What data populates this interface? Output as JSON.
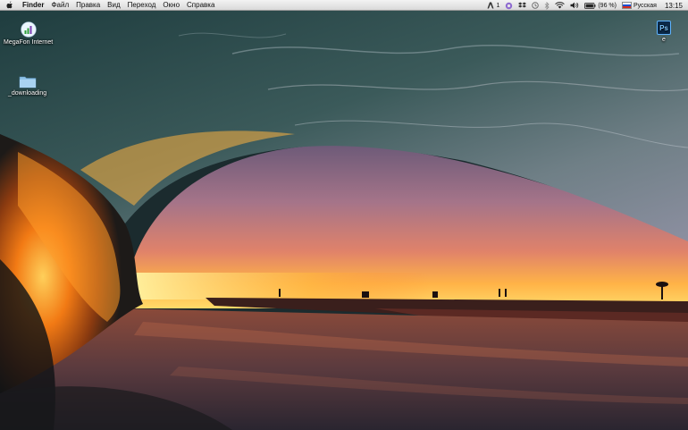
{
  "menubar": {
    "app_name": "Finder",
    "items": [
      {
        "label": "Файл"
      },
      {
        "label": "Правка"
      },
      {
        "label": "Вид"
      },
      {
        "label": "Переход"
      },
      {
        "label": "Окно"
      },
      {
        "label": "Справка"
      }
    ],
    "status": {
      "notification_count": "1",
      "battery_text": "(96 %)",
      "input_language": "Русская",
      "clock": "13:15"
    }
  },
  "desktop": {
    "icons": [
      {
        "label": "MegaFon Internet",
        "icon": "modem-signal-icon"
      },
      {
        "label": "_downloading",
        "icon": "folder-icon"
      },
      {
        "label": "e",
        "icon": "photoshop-icon",
        "badge": "Ps"
      }
    ],
    "wallpaper": "sunset-wave-tube"
  },
  "colors": {
    "menubar_bg": "#e6e6e6",
    "sunset_orange": "#ff8a1c",
    "sky_pink": "#b07a9a",
    "ocean_teal": "#2e5a5e"
  }
}
